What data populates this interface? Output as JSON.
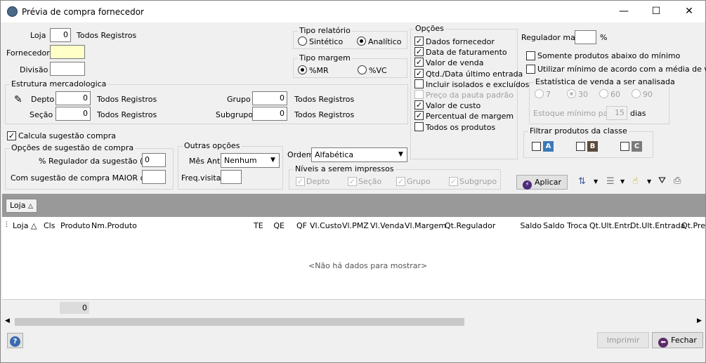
{
  "window": {
    "title": "Prévia de compra fornecedor",
    "minimize": "—",
    "maximize": "☐",
    "close": "✕"
  },
  "loja": {
    "label": "Loja",
    "value": "0",
    "all": "Todos Registros"
  },
  "fornecedor": {
    "label": "Fornecedor",
    "value": ""
  },
  "divisao": {
    "label": "Divisão",
    "value": ""
  },
  "estrutura": {
    "legend": "Estrutura mercadologica",
    "depto": {
      "label": "Depto",
      "value": "0",
      "all": "Todos Registros"
    },
    "secao": {
      "label": "Seção",
      "value": "0",
      "all": "Todos Registros"
    },
    "grupo": {
      "label": "Grupo",
      "value": "0",
      "all": "Todos Registros"
    },
    "subgrupo": {
      "label": "Subgrupo",
      "value": "0",
      "all": "Todos Registros"
    }
  },
  "tipo_relatorio": {
    "legend": "Tipo relatório",
    "sintetico": "Sintético",
    "analitico": "Analítico",
    "selected": "Analítico"
  },
  "tipo_margem": {
    "legend": "Tipo margem",
    "mr": "%MR",
    "vc": "%VC",
    "selected": "%MR"
  },
  "opcoes": {
    "legend": "Opções",
    "items": [
      {
        "label": "Dados fornecedor",
        "checked": true,
        "enabled": true
      },
      {
        "label": "Data de faturamento",
        "checked": true,
        "enabled": true
      },
      {
        "label": "Valor de venda",
        "checked": true,
        "enabled": true
      },
      {
        "label": "Qtd./Data último entrada",
        "checked": true,
        "enabled": true
      },
      {
        "label": "Incluir isolados e excluídos",
        "checked": false,
        "enabled": true
      },
      {
        "label": "Preço da pauta padrão",
        "checked": false,
        "enabled": false
      },
      {
        "label": "Valor de custo",
        "checked": true,
        "enabled": true
      },
      {
        "label": "Percentual de margem",
        "checked": true,
        "enabled": true
      },
      {
        "label": "Todos os produtos",
        "checked": false,
        "enabled": true
      }
    ]
  },
  "regulador": {
    "label": "Regulador mais",
    "value": "",
    "unit": "%"
  },
  "somente_abaixo": {
    "label": "Somente produtos abaixo do mínimo",
    "checked": false
  },
  "utilizar_minimo": {
    "label": "Utilizar mínimo de acordo com a média de vendas",
    "checked": false
  },
  "estatistica": {
    "legend": "Estatística de venda a ser analisada",
    "options": [
      "7",
      "30",
      "60",
      "90"
    ],
    "selected": "30",
    "estoque_label": "Estoque mínimo para",
    "estoque_value": "15",
    "dias": "dias"
  },
  "filtrar_classe": {
    "legend": "Filtrar produtos da classe",
    "classes": [
      {
        "letter": "A",
        "color": "#3a7ab8"
      },
      {
        "letter": "B",
        "color": "#5a4a3a"
      },
      {
        "letter": "C",
        "color": "#7a7a7a"
      }
    ]
  },
  "calcula": {
    "label": "Calcula sugestão compra",
    "checked": true
  },
  "opcoes_sugestao": {
    "legend": "Opções de sugestão de compra",
    "regulador_label": "% Regulador da sugestão (+-)",
    "regulador_value": "0",
    "maior_label": "Com sugestão de compra MAIOR que",
    "maior_value": ""
  },
  "outras": {
    "legend": "Outras opções",
    "mes_label": "Mês Ant.",
    "mes_value": "Nenhum",
    "freq_label": "Freq.visita",
    "freq_value": ""
  },
  "ordem": {
    "label": "Ordem",
    "value": "Alfabética"
  },
  "niveis": {
    "legend": "Níveis a serem impressos",
    "items": [
      "Depto",
      "Seção",
      "Grupo",
      "Subgrupo"
    ]
  },
  "aplicar": "Aplicar",
  "group_tag": "Loja",
  "grid": {
    "columns": [
      "Loja",
      "Cls",
      "Produto",
      "Nm.Produto",
      "TE",
      "QE",
      "QF",
      "Vl.Custo",
      "Vl.PMZ",
      "Vl.Venda",
      "Vl.Margem",
      "Qt.Regulador",
      "Saldo",
      "Saldo Troca",
      "Qt.Ult.Entr.",
      "Dt.Ult.Entrada",
      "Qt.Prev"
    ],
    "empty": "<Não há dados para mostrar>",
    "footer_total": "0"
  },
  "footer": {
    "help": "?",
    "imprimir": "Imprimir",
    "fechar": "Fechar"
  },
  "colors": {
    "grid_header_bg": "#999999",
    "selected_input": "#ffffc8"
  }
}
